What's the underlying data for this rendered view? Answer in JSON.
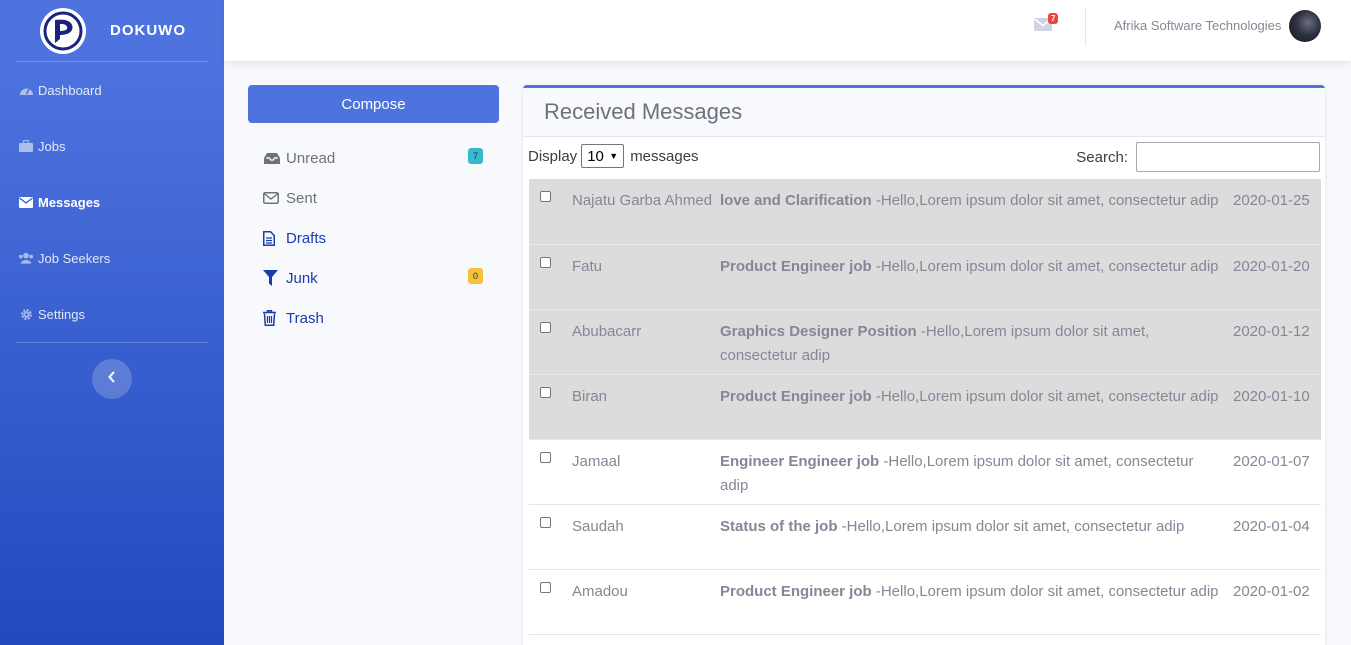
{
  "brand": {
    "name": "DOKUWO"
  },
  "sidebar": {
    "items": [
      {
        "label": "Dashboard",
        "icon": "dashboard-icon",
        "active": false
      },
      {
        "label": "Jobs",
        "icon": "briefcase-icon",
        "active": false
      },
      {
        "label": "Messages",
        "icon": "envelope-icon",
        "active": true
      },
      {
        "label": "Job Seekers",
        "icon": "users-icon",
        "active": false
      },
      {
        "label": "Settings",
        "icon": "gear-icon",
        "active": false
      }
    ]
  },
  "topbar": {
    "mail_count": "7",
    "user_name": "Afrika Software Technologies"
  },
  "mailbox": {
    "compose_label": "Compose",
    "folders": [
      {
        "label": "Unread",
        "icon": "inbox-icon",
        "badge": "7",
        "badge_color": "#36b9cc"
      },
      {
        "label": "Sent",
        "icon": "envelope-outline-icon"
      },
      {
        "label": "Drafts",
        "icon": "file-icon"
      },
      {
        "label": "Junk",
        "icon": "filter-icon",
        "badge": "0",
        "badge_color": "#f6c23e"
      },
      {
        "label": "Trash",
        "icon": "trash-icon"
      }
    ]
  },
  "messages_panel": {
    "title": "Received Messages",
    "display_label": "Display",
    "display_value": "10",
    "display_suffix": "messages",
    "search_label": "Search:",
    "search_value": "",
    "rows": [
      {
        "from": "Najatu Garba Ahmed",
        "subject": "love and Clarification",
        "preview": "-Hello,Lorem ipsum dolor sit amet, consectetur adip",
        "date": "2020-01-25",
        "unread": true
      },
      {
        "from": "Fatu",
        "subject": "Product Engineer job",
        "preview": "-Hello,Lorem ipsum dolor sit amet, consectetur adip",
        "date": "2020-01-20",
        "unread": true
      },
      {
        "from": "Abubacarr",
        "subject": "Graphics Designer Position",
        "preview": "-Hello,Lorem ipsum dolor sit amet, consectetur adip",
        "date": "2020-01-12",
        "unread": true
      },
      {
        "from": "Biran",
        "subject": "Product Engineer job",
        "preview": "-Hello,Lorem ipsum dolor sit amet, consectetur adip",
        "date": "2020-01-10",
        "unread": true
      },
      {
        "from": "Jamaal",
        "subject": "Engineer Engineer job",
        "preview": "-Hello,Lorem ipsum dolor sit amet, consectetur adip",
        "date": "2020-01-07",
        "unread": false
      },
      {
        "from": "Saudah",
        "subject": "Status of the job",
        "preview": "-Hello,Lorem ipsum dolor sit amet, consectetur adip",
        "date": "2020-01-04",
        "unread": false
      },
      {
        "from": "Amadou",
        "subject": "Product Engineer job",
        "preview": "-Hello,Lorem ipsum dolor sit amet, consectetur adip",
        "date": "2020-01-02",
        "unread": false
      }
    ]
  }
}
